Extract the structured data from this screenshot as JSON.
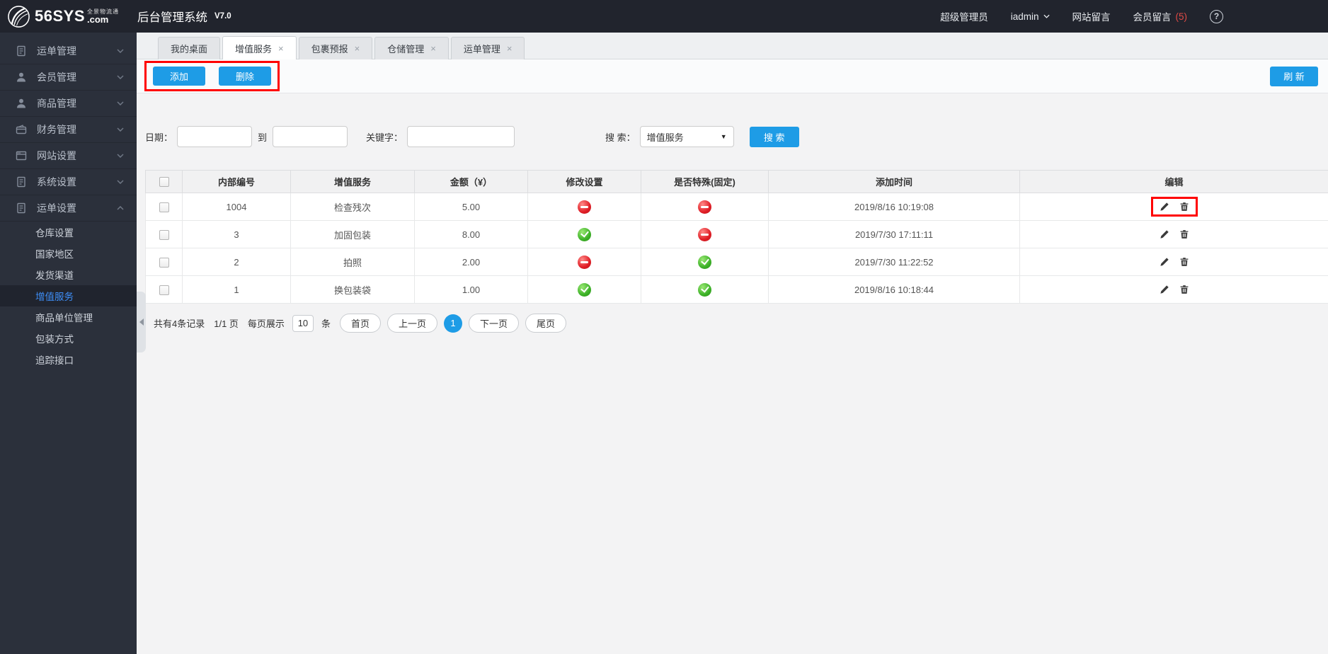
{
  "colors": {
    "accent": "#1e9ce6",
    "annotation": "#ff0000",
    "sidebar_active_text": "#3e8ef7",
    "message_count_red": "#e04a45",
    "status_yes_green": "#3cb127",
    "status_no_red": "#e01d25"
  },
  "header": {
    "logo_text": "56SYS",
    "logo_suffix": ".com",
    "logo_tagline": "全景物流通",
    "app_title": "后台管理系统",
    "version": "V7.0",
    "role": "超级管理员",
    "username": "iadmin",
    "site_messages": "网站留言",
    "member_messages": "会员留言",
    "member_message_count": "(5)",
    "help_label": "?"
  },
  "sidebar": {
    "items": [
      {
        "key": "waybill-management",
        "label": "运单管理",
        "icon": "waybill-icon",
        "state": "collapsed"
      },
      {
        "key": "member-management",
        "label": "会员管理",
        "icon": "member-icon",
        "state": "collapsed"
      },
      {
        "key": "product-management",
        "label": "商品管理",
        "icon": "product-icon",
        "state": "collapsed"
      },
      {
        "key": "finance-management",
        "label": "财务管理",
        "icon": "finance-icon",
        "state": "collapsed"
      },
      {
        "key": "website-settings",
        "label": "网站设置",
        "icon": "website-icon",
        "state": "collapsed"
      },
      {
        "key": "system-settings",
        "label": "系统设置",
        "icon": "system-icon",
        "state": "collapsed"
      },
      {
        "key": "waybill-settings",
        "label": "运单设置",
        "icon": "waybill-settings-icon",
        "state": "expanded"
      }
    ],
    "submenu": [
      {
        "key": "warehouse-settings",
        "label": "仓库设置",
        "active": false
      },
      {
        "key": "country-region",
        "label": "国家地区",
        "active": false
      },
      {
        "key": "shipping-channel",
        "label": "发货渠道",
        "active": false
      },
      {
        "key": "value-added-service",
        "label": "增值服务",
        "active": true
      },
      {
        "key": "product-unit",
        "label": "商品单位管理",
        "active": false
      },
      {
        "key": "packaging-method",
        "label": "包装方式",
        "active": false
      },
      {
        "key": "tracking-api",
        "label": "追踪接口",
        "active": false
      }
    ]
  },
  "tabs": [
    {
      "key": "my-desktop",
      "label": "我的桌面",
      "closable": false,
      "active": false
    },
    {
      "key": "value-added-service",
      "label": "增值服务",
      "closable": true,
      "active": true
    },
    {
      "key": "package-forecast",
      "label": "包裹预报",
      "closable": true,
      "active": false
    },
    {
      "key": "warehouse-management",
      "label": "仓储管理",
      "closable": true,
      "active": false
    },
    {
      "key": "waybill-management",
      "label": "运单管理",
      "closable": true,
      "active": false
    }
  ],
  "toolbar": {
    "add": "添加",
    "delete": "删除",
    "refresh": "刷 新"
  },
  "filters": {
    "date_label": "日期：",
    "to_label": "到",
    "keyword_label": "关键字：",
    "search_label": "搜 索：",
    "search_type_selected": "增值服务",
    "search_button": "搜 索",
    "date_from": "",
    "date_to": "",
    "keyword": ""
  },
  "table": {
    "headers": [
      "内部编号",
      "增值服务",
      "金额（¥）",
      "修改设置",
      "是否特殊(固定)",
      "添加时间",
      "编辑"
    ],
    "rows": [
      {
        "internal_id": "1004",
        "service": "检查残次",
        "amount": "5.00",
        "modifiable": "no",
        "special": "no",
        "added_time": "2019/8/16 10:19:08",
        "annotated": true
      },
      {
        "internal_id": "3",
        "service": "加固包装",
        "amount": "8.00",
        "modifiable": "yes",
        "special": "no",
        "added_time": "2019/7/30 17:11:11",
        "annotated": false
      },
      {
        "internal_id": "2",
        "service": "拍照",
        "amount": "2.00",
        "modifiable": "no",
        "special": "yes",
        "added_time": "2019/7/30 11:22:52",
        "annotated": false
      },
      {
        "internal_id": "1",
        "service": "换包装袋",
        "amount": "1.00",
        "modifiable": "yes",
        "special": "yes",
        "added_time": "2019/8/16 10:18:44",
        "annotated": false
      }
    ]
  },
  "pagination": {
    "total": "共有4条记录",
    "page_info": "1/1 页",
    "per_page_label": "每页展示",
    "per_page_value": "10",
    "unit": "条",
    "first": "首页",
    "prev": "上一页",
    "current": "1",
    "next": "下一页",
    "last": "尾页"
  }
}
